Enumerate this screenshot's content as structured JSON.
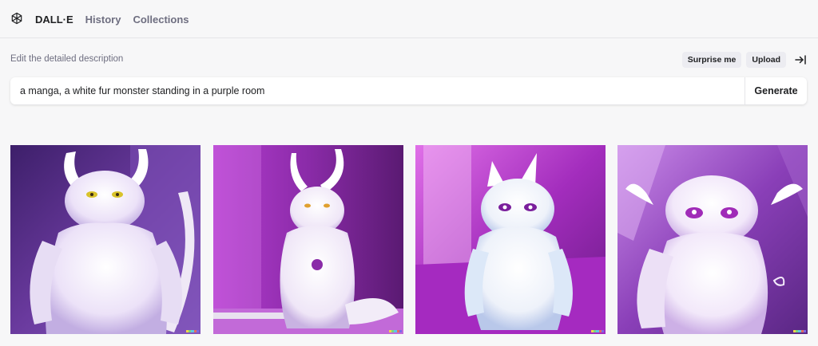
{
  "header": {
    "brand": "DALL·E",
    "nav": [
      "History",
      "Collections"
    ]
  },
  "editor": {
    "label": "Edit the detailed description",
    "surprise_label": "Surprise me",
    "upload_label": "Upload",
    "prompt_value": "a manga, a white fur monster standing in a purple room",
    "generate_label": "Generate"
  },
  "icons": {
    "logo": "openai-logo-icon",
    "collapse": "collapse-panel-icon"
  },
  "results": [
    {
      "name": "generated-image-1",
      "accent": "#5b2a86",
      "eyes": "#d8c22a"
    },
    {
      "name": "generated-image-2",
      "accent": "#9b2bb2",
      "eyes": "#e0a030"
    },
    {
      "name": "generated-image-3",
      "accent": "#b43bc7",
      "eyes": "#7a1f9c"
    },
    {
      "name": "generated-image-4",
      "accent": "#8e3cb8",
      "eyes": "#a02bb8"
    }
  ],
  "colors": {
    "background": "#f7f7f8",
    "signature": [
      "#f2d64a",
      "#7fd67a",
      "#5fc6e6",
      "#e66b5f",
      "#7c6ae6"
    ]
  }
}
